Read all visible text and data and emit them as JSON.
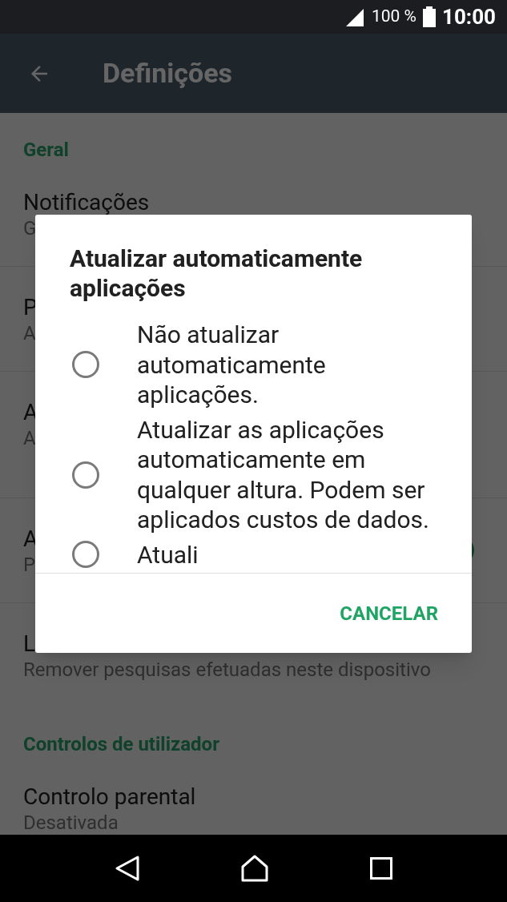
{
  "status_bar": {
    "battery": "100 %",
    "time": "10:00"
  },
  "app_bar": {
    "title": "Definições"
  },
  "sections": [
    {
      "header": "Geral",
      "items": [
        {
          "kind": "plain",
          "title": "Notificações",
          "subtitles": [
            "G"
          ]
        },
        {
          "kind": "plain",
          "title": "P",
          "subtitles": [
            "A"
          ]
        },
        {
          "kind": "plain",
          "title": "A",
          "subtitles": [
            "A"
          ]
        },
        {
          "kind": "switch",
          "title": "A",
          "subtitles": [
            "P"
          ],
          "on": true
        },
        {
          "kind": "plain",
          "title": "L",
          "subtitles": [
            "Remover pesquisas efetuadas neste dispositivo"
          ]
        }
      ]
    },
    {
      "header": "Controlos de utilizador",
      "items": [
        {
          "kind": "plain",
          "title": "Controlo parental",
          "subtitles": [
            "Desativada"
          ]
        }
      ]
    }
  ],
  "dialog": {
    "title": "Atualizar automaticamente aplicações",
    "options": [
      {
        "label": "Não atualizar automaticamente aplicações.",
        "selected": false
      },
      {
        "label": "Atualizar as aplicações automaticamente em qualquer altura. Podem ser aplicados custos de dados.",
        "selected": false
      },
      {
        "label": "Atuali",
        "selected": false
      }
    ],
    "button": "CANCELAR"
  }
}
